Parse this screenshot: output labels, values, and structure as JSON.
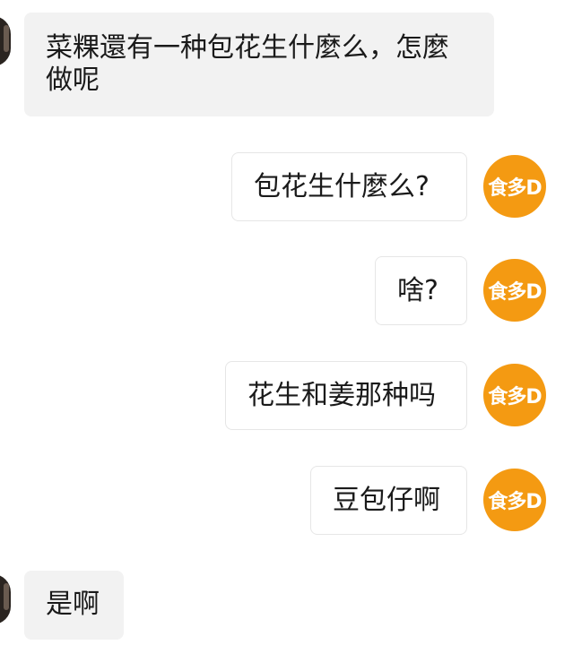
{
  "messages": [
    {
      "side": "in",
      "text": "菜粿還有一种包花生什麼么，怎麼做呢"
    },
    {
      "side": "out",
      "text": "包花生什麼么?"
    },
    {
      "side": "out",
      "text": "啥?"
    },
    {
      "side": "out",
      "text": "花生和姜那种吗"
    },
    {
      "side": "out",
      "text": "豆包仔啊"
    },
    {
      "side": "in",
      "text": "是啊"
    }
  ],
  "avatars": {
    "self_label": "食多D",
    "self_color": "#f49a12",
    "other_color": "#2a2420"
  }
}
